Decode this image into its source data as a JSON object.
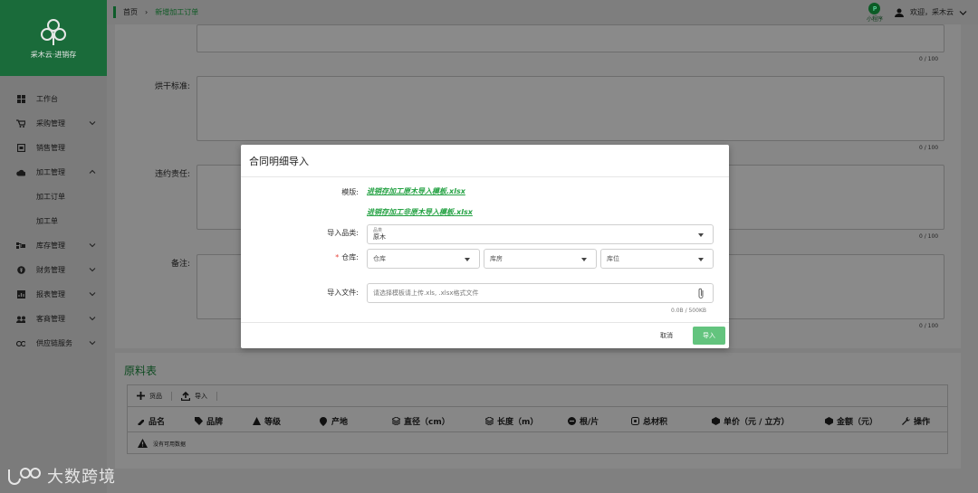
{
  "app": {
    "brand": "采木云·进销存",
    "accent": "#1a6b3a"
  },
  "sidebar": {
    "items": [
      {
        "label": "工作台",
        "icon": "dashboard-icon"
      },
      {
        "label": "采购管理",
        "icon": "cart-icon"
      },
      {
        "label": "销售管理",
        "icon": "sales-icon"
      },
      {
        "label": "加工管理",
        "icon": "cloud-icon"
      },
      {
        "label": "加工订单",
        "icon": ""
      },
      {
        "label": "加工单",
        "icon": ""
      },
      {
        "label": "库存管理",
        "icon": "inventory-icon"
      },
      {
        "label": "财务管理",
        "icon": "finance-icon"
      },
      {
        "label": "报表管理",
        "icon": "report-icon"
      },
      {
        "label": "客商管理",
        "icon": "people-icon"
      },
      {
        "label": "供应链服务",
        "icon": "link-icon"
      }
    ]
  },
  "header": {
    "breadcrumb": [
      "首页",
      "新增加工订单"
    ],
    "mini_label": "小程序",
    "welcome": "欢迎，采木云"
  },
  "form": {
    "fields": [
      {
        "label": "",
        "count": "0 / 100"
      },
      {
        "label": "烘干标准:",
        "count": "0 / 100"
      },
      {
        "label": "违约责任:",
        "count": "0 / 100"
      },
      {
        "label": "备注:",
        "count": "0 / 100"
      }
    ]
  },
  "raw": {
    "title": "原料表",
    "toolbar": [
      "货品",
      "导入"
    ],
    "columns": [
      "品名",
      "品牌",
      "等级",
      "产地",
      "直径（cm）",
      "长度（m）",
      "根/片",
      "总材积",
      "单价（元 / 立方）",
      "金额（元）",
      "操作"
    ],
    "empty": "没有可用数据"
  },
  "modal": {
    "title": "合同明细导入",
    "template_label": "模版:",
    "template_links": [
      "进销存加工原木导入模板.xlsx",
      "进销存加工非原木导入模板.xlsx"
    ],
    "category_label": "导入品类:",
    "category_small": "品类",
    "category_value": "原木",
    "warehouse_label": "仓库:",
    "warehouse_req": "*",
    "warehouse_placeholders": [
      "仓库",
      "库房",
      "库位"
    ],
    "file_label": "导入文件:",
    "file_placeholder": "请选择模板请上传.xls, .xlsx格式文件",
    "file_size": "0.0B / 500KB",
    "cancel": "取消",
    "import": "导入"
  },
  "watermark": {
    "text": "大数跨境"
  }
}
